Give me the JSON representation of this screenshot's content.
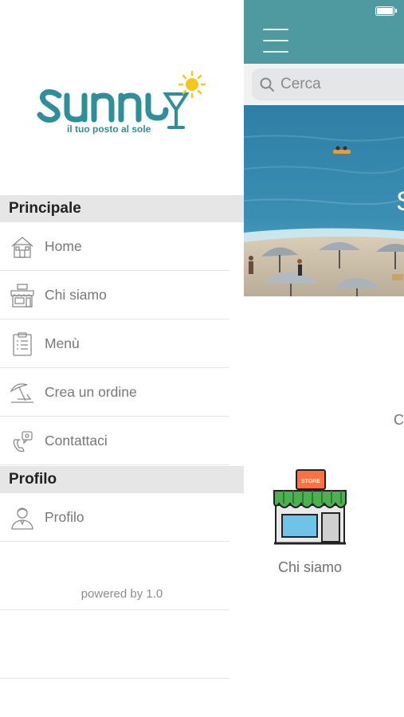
{
  "main": {
    "search": {
      "placeholder": "Cerca"
    },
    "peek_text_banner": "S",
    "peek_text_side": "C",
    "tiles": [
      {
        "label": "Chi siamo",
        "badge": "STORE",
        "icon": "store-icon"
      }
    ]
  },
  "drawer": {
    "logo": {
      "brand": "sunny",
      "tagline": "il tuo posto al sole"
    },
    "sections": [
      {
        "title": "Principale",
        "items": [
          {
            "label": "Home",
            "icon": "house-icon"
          },
          {
            "label": "Chi siamo",
            "icon": "shop-icon"
          },
          {
            "label": "Menù",
            "icon": "clipboard-menu-icon"
          },
          {
            "label": "Crea un ordine",
            "icon": "beach-umbrella-icon"
          },
          {
            "label": "Contattaci",
            "icon": "contact-phone-icon"
          }
        ]
      },
      {
        "title": "Profilo",
        "items": [
          {
            "label": "Profilo",
            "icon": "user-profile-icon"
          }
        ]
      }
    ],
    "footer": {
      "powered_by": "powered by  1.0"
    }
  },
  "colors": {
    "topbar": "#4f9aa0",
    "brand_teal": "#2e8f9a",
    "brand_yellow": "#f5c518",
    "section_header_bg": "#e6e6e6",
    "menu_text": "#777777"
  }
}
